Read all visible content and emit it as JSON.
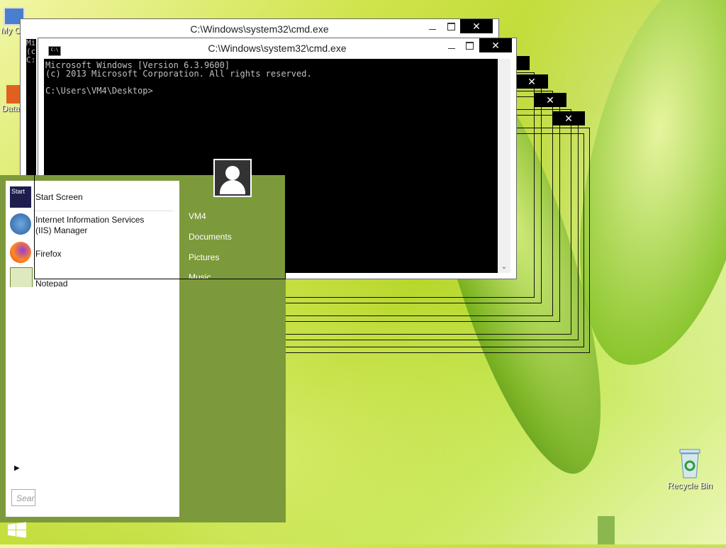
{
  "desktop": {
    "icons": [
      {
        "label": "My C..."
      },
      {
        "label": "Data..."
      },
      {
        "label": "Recycle Bin"
      }
    ]
  },
  "windows": {
    "back_title": "C:\\Windows\\system32\\cmd.exe",
    "front_title": "C:\\Windows\\system32\\cmd.exe",
    "sys_icon_text": "C:\\",
    "close_glyph": "✕",
    "console_lines": [
      "Microsoft Windows [Version 6.3.9600]",
      "(c) 2013 Microsoft Corporation. All rights reserved.",
      "",
      "C:\\Users\\VM4\\Desktop>"
    ],
    "back_console_fragment": [
      "Mi",
      "(c",
      "",
      "C:"
    ],
    "scroll_down": "⌄"
  },
  "start_menu": {
    "items": [
      {
        "label": "Start Screen",
        "icon": "start-screen-icon"
      },
      {
        "label": "Internet Information Services (IIS) Manager",
        "icon": "iis-icon"
      },
      {
        "label": "Firefox",
        "icon": "firefox-icon"
      },
      {
        "label": "Notepad",
        "icon": "notepad-icon"
      }
    ],
    "start_tile_label": "Start",
    "user": "VM4",
    "links": [
      "Documents",
      "Pictures",
      "Music"
    ],
    "search_placeholder": "Sear",
    "expand_arrow": "▶"
  },
  "colors": {
    "start_menu_bg": "#7c9a3b",
    "console_bg": "#000000",
    "console_fg": "#c0c0c0"
  }
}
